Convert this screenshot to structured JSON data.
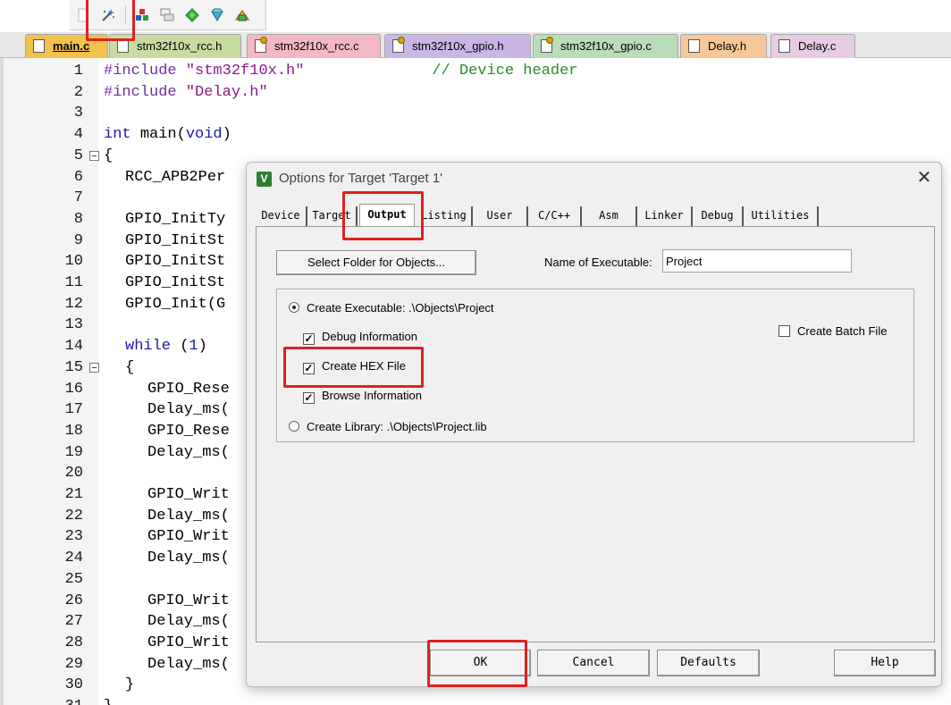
{
  "toolbar": {
    "icons": [
      "blank-doc-icon",
      "magic-wand-icon",
      "colored-blocks-icon",
      "stacked-windows-icon",
      "green-diamond-icon",
      "download-gem-icon",
      "build-blocks-icon"
    ]
  },
  "file_tabs": [
    {
      "label": "main.c",
      "color": "#f2c14e",
      "active": true
    },
    {
      "label": "stm32f10x_rcc.h",
      "color": "#c8dca2"
    },
    {
      "label": "stm32f10x_rcc.c",
      "color": "#f4b8c4"
    },
    {
      "label": "stm32f10x_gpio.h",
      "color": "#c9b6e4"
    },
    {
      "label": "stm32f10x_gpio.c",
      "color": "#b9dcb9"
    },
    {
      "label": "Delay.h",
      "color": "#f7c79a"
    },
    {
      "label": "Delay.c",
      "color": "#e6cde4"
    }
  ],
  "editor": {
    "lines": [
      {
        "n": "1"
      },
      {
        "n": "2"
      },
      {
        "n": "3"
      },
      {
        "n": "4"
      },
      {
        "n": "5"
      },
      {
        "n": "6"
      },
      {
        "n": "7"
      },
      {
        "n": "8"
      },
      {
        "n": "9"
      },
      {
        "n": "10"
      },
      {
        "n": "11"
      },
      {
        "n": "12"
      },
      {
        "n": "13"
      },
      {
        "n": "14"
      },
      {
        "n": "15"
      },
      {
        "n": "16"
      },
      {
        "n": "17"
      },
      {
        "n": "18"
      },
      {
        "n": "19"
      },
      {
        "n": "20"
      },
      {
        "n": "21"
      },
      {
        "n": "22"
      },
      {
        "n": "23"
      },
      {
        "n": "24"
      },
      {
        "n": "25"
      },
      {
        "n": "26"
      },
      {
        "n": "27"
      },
      {
        "n": "28"
      },
      {
        "n": "29"
      },
      {
        "n": "30"
      },
      {
        "n": "31"
      }
    ],
    "code": {
      "l1_pp": "#include",
      "l1_str": "\"stm32f10x.h\"",
      "l1_cmt": "// Device header",
      "l2_pp": "#include",
      "l2_str": "\"Delay.h\"",
      "l4_kw": "int",
      "l4_name": "main(",
      "l4_void": "void",
      "l4_close": ")",
      "l5": "{",
      "l6": "RCC_APB2Per",
      "l8": "GPIO_InitTy",
      "l9": "GPIO_InitSt",
      "l10": "GPIO_InitSt",
      "l11": "GPIO_InitSt",
      "l12": "GPIO_Init(G",
      "l14_kw": "while",
      "l14_open": " (",
      "l14_num": "1",
      "l14_close": ")",
      "l15": "{",
      "l16": "GPIO_Rese",
      "l17": "Delay_ms(",
      "l18": "GPIO_Rese",
      "l19": "Delay_ms(",
      "l21": "GPIO_Writ",
      "l22": "Delay_ms(",
      "l23": "GPIO_Writ",
      "l24": "Delay_ms(",
      "l26": "GPIO_Writ",
      "l27": "Delay_ms(",
      "l28": "GPIO_Writ",
      "l29": "Delay_ms(",
      "l30": "}",
      "l31": "}"
    }
  },
  "dialog": {
    "title": "Options for Target 'Target 1'",
    "close_glyph": "✕",
    "tabs": [
      "Device",
      "Target",
      "Output",
      "Listing",
      "User",
      "C/C++",
      "Asm",
      "Linker",
      "Debug",
      "Utilities"
    ],
    "active_tab": "Output",
    "select_folder_label": "Select Folder for Objects...",
    "name_of_executable_label": "Name of Executable:",
    "name_of_executable_value": "Project",
    "create_executable_label": "Create Executable:  .\\Objects\\Project",
    "debug_information_label": "Debug Information",
    "create_hex_label": "Create HEX File",
    "browse_information_label": "Browse Information",
    "create_library_label": "Create Library:  .\\Objects\\Project.lib",
    "create_batch_label": "Create Batch File",
    "check_mark": "✓",
    "ok_label": "OK",
    "cancel_label": "Cancel",
    "defaults_label": "Defaults",
    "help_label": "Help",
    "title_icon_letter": "V"
  },
  "state": {
    "create_executable": true,
    "create_library": false,
    "debug_information": true,
    "create_hex_file": true,
    "browse_information": true,
    "create_batch_file": false
  },
  "annotations": {
    "highlight_color": "#e02020"
  }
}
